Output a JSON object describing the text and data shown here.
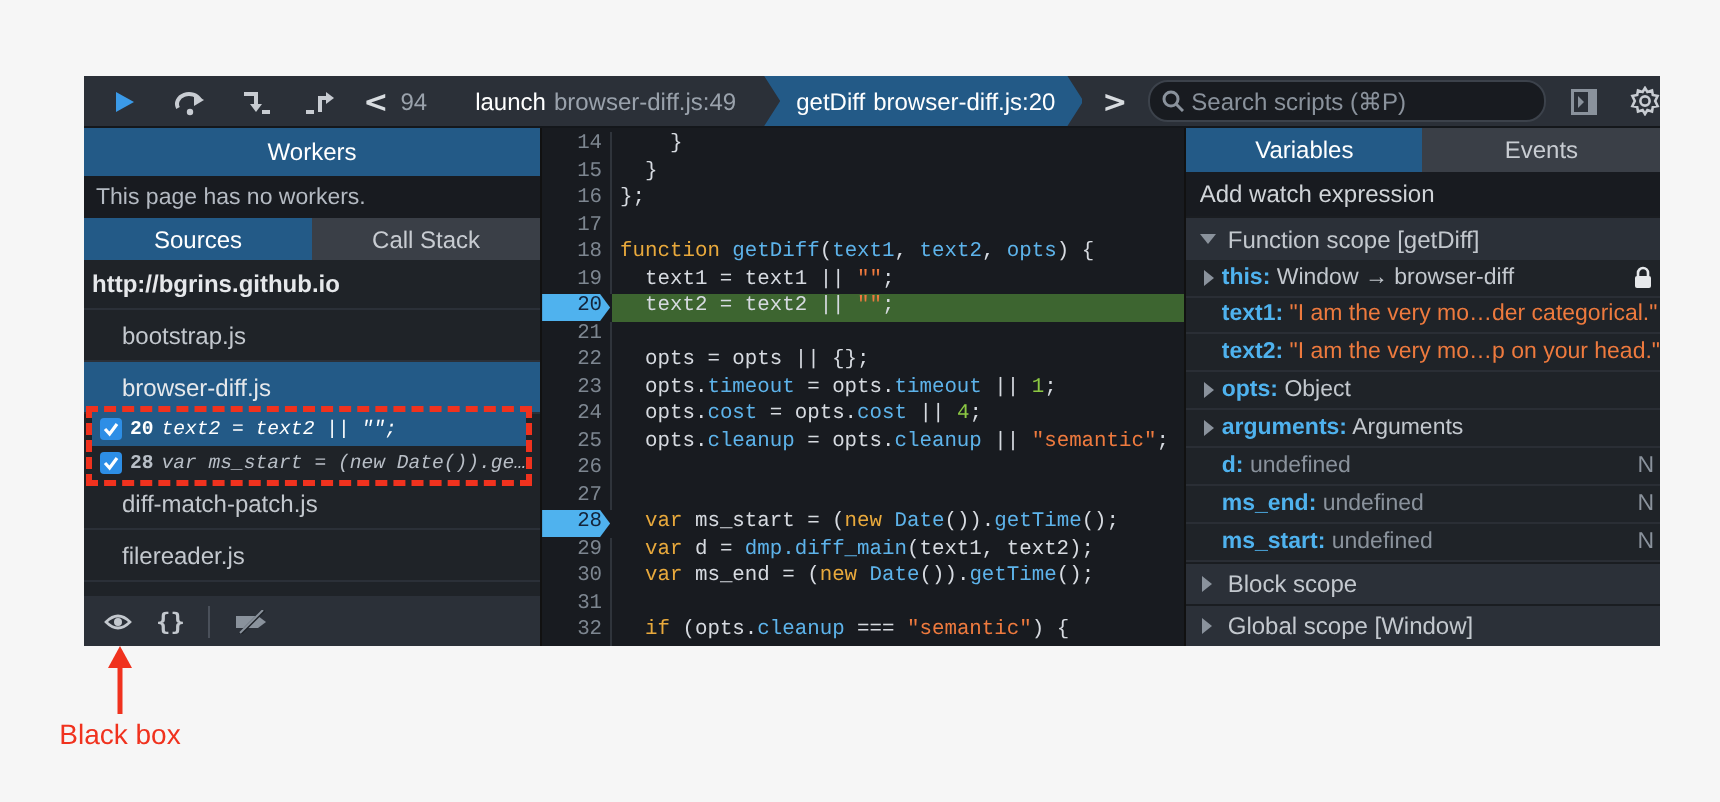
{
  "toolbar": {
    "buttons": [
      {
        "kind": "resume"
      },
      {
        "kind": "step-over"
      },
      {
        "kind": "step-in"
      },
      {
        "kind": "step-out"
      }
    ],
    "back": "<",
    "forward": ">",
    "breadcrumbs": [
      {
        "location": "94",
        "selected": false
      },
      {
        "function": "launch",
        "location": "browser-diff.js:49",
        "selected": false
      },
      {
        "function": "getDiff",
        "location": "browser-diff.js:20",
        "selected": true
      }
    ],
    "search": {
      "placeholder": "Search scripts (⌘P)"
    }
  },
  "sidebar": {
    "workers": {
      "title": "Workers",
      "message": "This page has no workers."
    },
    "tabs": [
      {
        "label": "Sources",
        "selected": true
      },
      {
        "label": "Call Stack",
        "selected": false
      }
    ],
    "origin": "http://bgrins.github.io",
    "files": [
      {
        "name": "bootstrap.js",
        "selected": false
      },
      {
        "name": "browser-diff.js",
        "selected": true,
        "breakpoints": [
          {
            "line": "20",
            "code": "text2 = text2 || \"\";",
            "checked": true,
            "selected": true
          },
          {
            "line": "28",
            "code": "var ms_start = (new Date()).ge…",
            "checked": true,
            "selected": false
          }
        ]
      },
      {
        "name": "diff-match-patch.js",
        "selected": false
      },
      {
        "name": "filereader.js",
        "selected": false
      }
    ],
    "footer": {
      "pretty_print": "{}"
    }
  },
  "editor": {
    "lines": [
      {
        "number": "14",
        "breakpoint": false,
        "paused": false,
        "tokens": [
          {
            "kind": "plain",
            "text": "    }"
          }
        ]
      },
      {
        "number": "15",
        "breakpoint": false,
        "paused": false,
        "tokens": [
          {
            "kind": "plain",
            "text": "  }"
          }
        ]
      },
      {
        "number": "16",
        "breakpoint": false,
        "paused": false,
        "tokens": [
          {
            "kind": "plain",
            "text": "};"
          }
        ]
      },
      {
        "number": "17",
        "breakpoint": false,
        "paused": false
      },
      {
        "number": "18",
        "breakpoint": false,
        "paused": false,
        "tokens": [
          {
            "kind": "keyword",
            "text": "function "
          },
          {
            "kind": "identifier",
            "text": "getDiff"
          },
          {
            "kind": "plain",
            "text": "("
          },
          {
            "kind": "identifier",
            "text": "text1"
          },
          {
            "kind": "plain",
            "text": ", "
          },
          {
            "kind": "identifier",
            "text": "text2"
          },
          {
            "kind": "plain",
            "text": ", "
          },
          {
            "kind": "identifier",
            "text": "opts"
          },
          {
            "kind": "plain",
            "text": ") {"
          }
        ]
      },
      {
        "number": "19",
        "breakpoint": false,
        "paused": false,
        "tokens": [
          {
            "kind": "plain",
            "text": "  text1 = text1 || "
          },
          {
            "kind": "string",
            "text": "\"\""
          },
          {
            "kind": "plain",
            "text": ";"
          }
        ]
      },
      {
        "number": "20",
        "breakpoint": true,
        "paused": true,
        "tokens": [
          {
            "kind": "plain",
            "text": "  text2 = text2 || "
          },
          {
            "kind": "string",
            "text": "\"\""
          },
          {
            "kind": "plain",
            "text": ";"
          }
        ]
      },
      {
        "number": "21",
        "breakpoint": false,
        "paused": false
      },
      {
        "number": "22",
        "breakpoint": false,
        "paused": false,
        "tokens": [
          {
            "kind": "plain",
            "text": "  opts = opts || {};"
          }
        ]
      },
      {
        "number": "23",
        "breakpoint": false,
        "paused": false,
        "tokens": [
          {
            "kind": "plain",
            "text": "  opts."
          },
          {
            "kind": "identifier",
            "text": "timeout"
          },
          {
            "kind": "plain",
            "text": " = opts."
          },
          {
            "kind": "identifier",
            "text": "timeout"
          },
          {
            "kind": "plain",
            "text": " || "
          },
          {
            "kind": "number",
            "text": "1"
          },
          {
            "kind": "plain",
            "text": ";"
          }
        ]
      },
      {
        "number": "24",
        "breakpoint": false,
        "paused": false,
        "tokens": [
          {
            "kind": "plain",
            "text": "  opts."
          },
          {
            "kind": "identifier",
            "text": "cost"
          },
          {
            "kind": "plain",
            "text": " = opts."
          },
          {
            "kind": "identifier",
            "text": "cost"
          },
          {
            "kind": "plain",
            "text": " || "
          },
          {
            "kind": "number",
            "text": "4"
          },
          {
            "kind": "plain",
            "text": ";"
          }
        ]
      },
      {
        "number": "25",
        "breakpoint": false,
        "paused": false,
        "tokens": [
          {
            "kind": "plain",
            "text": "  opts."
          },
          {
            "kind": "identifier",
            "text": "cleanup"
          },
          {
            "kind": "plain",
            "text": " = opts."
          },
          {
            "kind": "identifier",
            "text": "cleanup"
          },
          {
            "kind": "plain",
            "text": " || "
          },
          {
            "kind": "string",
            "text": "\"semantic\""
          },
          {
            "kind": "plain",
            "text": ";"
          }
        ]
      },
      {
        "number": "26",
        "breakpoint": false,
        "paused": false
      },
      {
        "number": "27",
        "breakpoint": false,
        "paused": false
      },
      {
        "number": "28",
        "breakpoint": true,
        "paused": false,
        "tokens": [
          {
            "kind": "keyword",
            "text": "  var"
          },
          {
            "kind": "plain",
            "text": " ms_start = ("
          },
          {
            "kind": "keyword",
            "text": "new "
          },
          {
            "kind": "identifier",
            "text": "Date"
          },
          {
            "kind": "plain",
            "text": "())."
          },
          {
            "kind": "identifier",
            "text": "getTime"
          },
          {
            "kind": "plain",
            "text": "();"
          }
        ]
      },
      {
        "number": "29",
        "breakpoint": false,
        "paused": false,
        "tokens": [
          {
            "kind": "keyword",
            "text": "  var"
          },
          {
            "kind": "plain",
            "text": " d = "
          },
          {
            "kind": "identifier",
            "text": "dmp.diff_main"
          },
          {
            "kind": "plain",
            "text": "(text1, text2);"
          }
        ]
      },
      {
        "number": "30",
        "breakpoint": false,
        "paused": false,
        "tokens": [
          {
            "kind": "keyword",
            "text": "  var"
          },
          {
            "kind": "plain",
            "text": " ms_end = ("
          },
          {
            "kind": "keyword",
            "text": "new "
          },
          {
            "kind": "identifier",
            "text": "Date"
          },
          {
            "kind": "plain",
            "text": "())."
          },
          {
            "kind": "identifier",
            "text": "getTime"
          },
          {
            "kind": "plain",
            "text": "();"
          }
        ]
      },
      {
        "number": "31",
        "breakpoint": false,
        "paused": false
      },
      {
        "number": "32",
        "breakpoint": false,
        "paused": false,
        "tokens": [
          {
            "kind": "keyword",
            "text": "  if"
          },
          {
            "kind": "plain",
            "text": " (opts."
          },
          {
            "kind": "identifier",
            "text": "cleanup"
          },
          {
            "kind": "plain",
            "text": " === "
          },
          {
            "kind": "string",
            "text": "\"semantic\""
          },
          {
            "kind": "plain",
            "text": ") {"
          }
        ]
      }
    ]
  },
  "inspector": {
    "tabs": [
      {
        "label": "Variables",
        "selected": true
      },
      {
        "label": "Events",
        "selected": false
      }
    ],
    "watch": {
      "placeholder": "Add watch expression"
    },
    "scopes": [
      {
        "title": "Function scope [getDiff]",
        "expanded": true,
        "variables": [
          {
            "name": "this:",
            "value": "Window → browser-diff",
            "kind": "object",
            "expandable": true,
            "locked": true
          },
          {
            "name": "text1:",
            "value": "\"I am the very mo…der categorical.\"",
            "kind": "string",
            "expandable": false
          },
          {
            "name": "text2:",
            "value": "\"I am the very mo…p on your head.\"",
            "kind": "string",
            "expandable": false
          },
          {
            "name": "opts:",
            "value": "Object",
            "kind": "object",
            "expandable": true
          },
          {
            "name": "arguments:",
            "value": "Arguments",
            "kind": "object",
            "expandable": true
          },
          {
            "name": "d:",
            "value": "undefined",
            "kind": "undefined",
            "expandable": false,
            "flag": "N"
          },
          {
            "name": "ms_end:",
            "value": "undefined",
            "kind": "undefined",
            "expandable": false,
            "flag": "N"
          },
          {
            "name": "ms_start:",
            "value": "undefined",
            "kind": "undefined",
            "expandable": false,
            "flag": "N"
          }
        ]
      },
      {
        "title": "Block scope",
        "expanded": false
      },
      {
        "title": "Global scope [Window]",
        "expanded": false
      }
    ]
  },
  "annotation": {
    "label": "Black box"
  }
}
